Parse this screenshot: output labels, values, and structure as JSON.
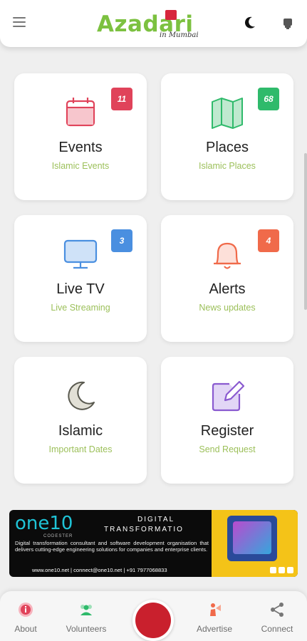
{
  "header": {
    "logo_text": "Azadari",
    "logo_subtitle": "in Mumbai"
  },
  "cards": [
    {
      "title": "Events",
      "subtitle": "Islamic Events",
      "badge": "11",
      "badge_color": "#e0435a",
      "icon": "calendar-icon",
      "icon_color": "#e0435a"
    },
    {
      "title": "Places",
      "subtitle": "Islamic Places",
      "badge": "68",
      "badge_color": "#2fba6b",
      "icon": "map-icon",
      "icon_color": "#2fba6b"
    },
    {
      "title": "Live TV",
      "subtitle": "Live Streaming",
      "badge": "3",
      "badge_color": "#4a8fe0",
      "icon": "tv-icon",
      "icon_color": "#4a8fe0"
    },
    {
      "title": "Alerts",
      "subtitle": "News updates",
      "badge": "4",
      "badge_color": "#f06a4a",
      "icon": "bell-icon",
      "icon_color": "#f06a4a"
    },
    {
      "title": "Islamic",
      "subtitle": "Important Dates",
      "icon": "crescent-icon",
      "icon_color": "#8a8a7a"
    },
    {
      "title": "Register",
      "subtitle": "Send Request",
      "icon": "edit-icon",
      "icon_color": "#8a5ad0"
    }
  ],
  "banner": {
    "brand": "one10",
    "brand_sub": "CODESTER",
    "heading_line1": "DIGITAL",
    "heading_line2": "TRANSFORMATIO",
    "body": "Digital transformation consultant and software development organisation that delivers cutting-edge engineering solutions for companies and enterprise clients.",
    "contact": "www.one10.net | connect@one10.net | +91 7977068833"
  },
  "bottom_nav": [
    {
      "label": "About",
      "icon": "info-icon",
      "color": "#e0435a"
    },
    {
      "label": "Volunteers",
      "icon": "users-icon",
      "color": "#2fba6b"
    },
    {
      "label": "Advertise",
      "icon": "advertise-icon",
      "color": "#f06a4a"
    },
    {
      "label": "Connect",
      "icon": "share-icon",
      "color": "#6e6e6e"
    }
  ],
  "colors": {
    "accent_green": "#7cc140",
    "subtitle_green": "#9cc05a",
    "home_red": "#c9202d"
  }
}
